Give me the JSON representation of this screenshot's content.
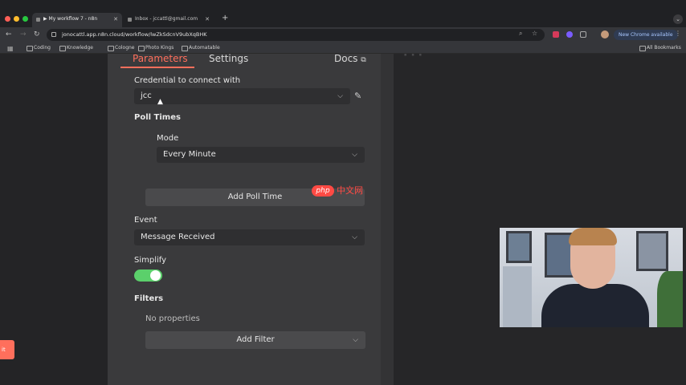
{
  "browser": {
    "tabs": [
      {
        "label": "▶ My workflow 7 - n8n",
        "active": true
      },
      {
        "label": "Inbox - jccattl@gmail.com",
        "active": false
      }
    ],
    "url": "jonocattl.app.n8n.cloud/workflow/lwZkSdcnV9ubXqBHK",
    "update_button": "New Chrome available",
    "bookmarks": [
      "Coding",
      "Knowledge",
      "Cologne",
      "Photo Kings",
      "Automatable"
    ],
    "all_bookmarks": "All Bookmarks",
    "colors": {
      "close": "#ff5f57",
      "minimize": "#febc2e",
      "maximize": "#28c840"
    }
  },
  "panel": {
    "tabs": {
      "parameters": "Parameters",
      "settings": "Settings",
      "docs": "Docs"
    },
    "credential": {
      "label": "Credential to connect with",
      "value": "jcc"
    },
    "poll_times": {
      "heading": "Poll Times",
      "mode_label": "Mode",
      "mode_value": "Every Minute",
      "add_button": "Add Poll Time"
    },
    "event": {
      "label": "Event",
      "value": "Message Received"
    },
    "simplify": {
      "label": "Simplify",
      "enabled": true
    },
    "filters": {
      "heading": "Filters",
      "empty_text": "No properties",
      "add_button": "Add Filter"
    },
    "accent_color": "#ff6f5c",
    "toggle_color": "#5bd06b"
  },
  "watermark": {
    "pill": "php",
    "text": "中文网"
  },
  "side_tab": {
    "label": "it"
  }
}
